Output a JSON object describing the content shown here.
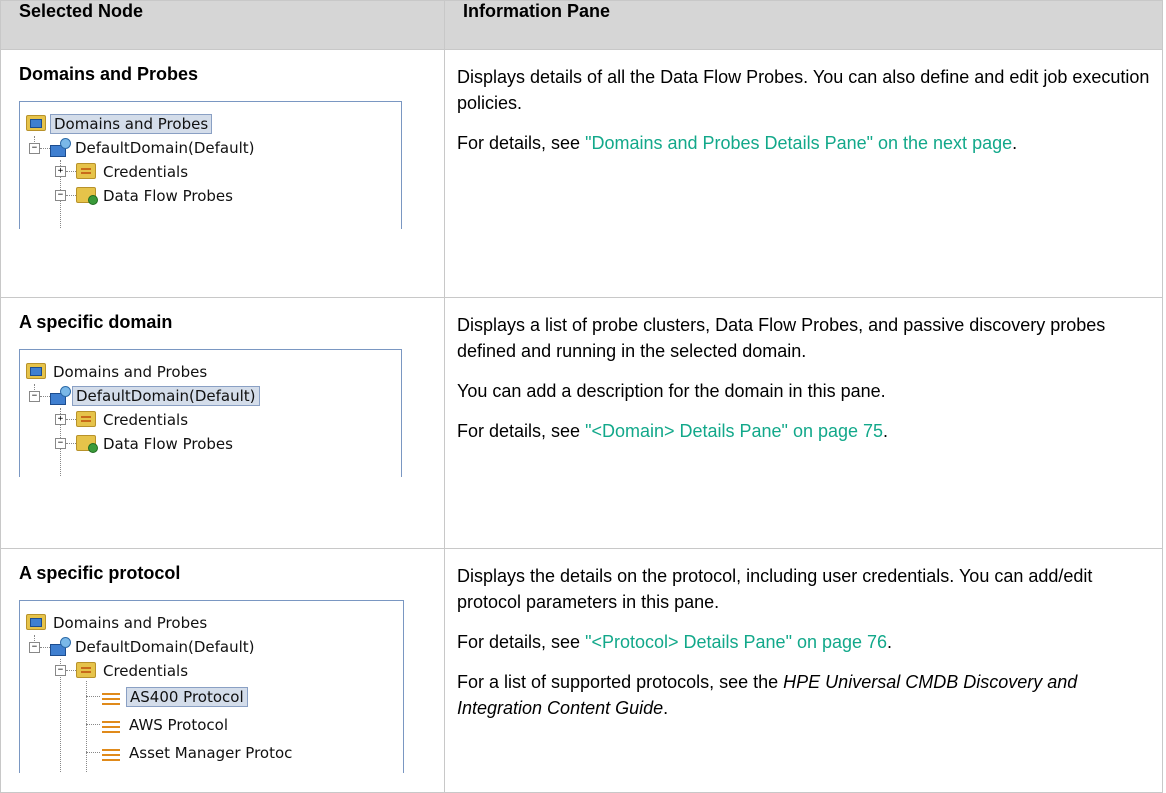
{
  "table": {
    "headers": [
      "Selected Node",
      "Information Pane"
    ],
    "rows": [
      {
        "node_title": "Domains and Probes",
        "tree": [
          "Domains and Probes",
          "DefaultDomain(Default)",
          "Credentials",
          "Data Flow Probes"
        ],
        "selected": "Domains and Probes",
        "info_p1": "Displays details of all the Data Flow Probes. You can also define and edit job execution policies.",
        "info_p2_prefix": "For details, see ",
        "info_p2_link": "\"Domains and Probes Details Pane\" on the next page",
        "info_p2_suffix": "."
      },
      {
        "node_title": "A specific domain",
        "tree": [
          "Domains and Probes",
          "DefaultDomain(Default)",
          "Credentials",
          "Data Flow Probes"
        ],
        "selected": "DefaultDomain(Default)",
        "info_p1": "Displays a list of probe clusters, Data Flow Probes, and passive discovery probes defined and running in the selected domain.",
        "info_p2": "You can add a description for the domain in this pane.",
        "info_p3_prefix": "For details, see ",
        "info_p3_link": "\"<Domain> Details Pane\" on page 75",
        "info_p3_suffix": "."
      },
      {
        "node_title": "A specific protocol",
        "tree": [
          "Domains and Probes",
          "DefaultDomain(Default)",
          "Credentials",
          "AS400 Protocol",
          "AWS Protocol",
          "Asset Manager Protoc"
        ],
        "selected": "AS400 Protocol",
        "info_p1": "Displays the details on the protocol, including user credentials. You can add/edit protocol parameters in this pane.",
        "info_p2_prefix": "For details, see ",
        "info_p2_link": "\"<Protocol> Details Pane\" on page 76",
        "info_p2_suffix": ".",
        "info_p3_prefix": "For a list of supported protocols, see the ",
        "info_p3_em": "HPE Universal CMDB Discovery and Integration Content Guide",
        "info_p3_suffix": "."
      }
    ]
  },
  "colors": {
    "link": "#12a88a",
    "header_bg": "#d6d6d6",
    "selection": "#d4ddea"
  },
  "icons": [
    "domains-folder-icon",
    "domain-computer-icon",
    "credentials-folder-icon",
    "probes-folder-icon",
    "protocol-icon",
    "expand-icon",
    "collapse-icon"
  ]
}
